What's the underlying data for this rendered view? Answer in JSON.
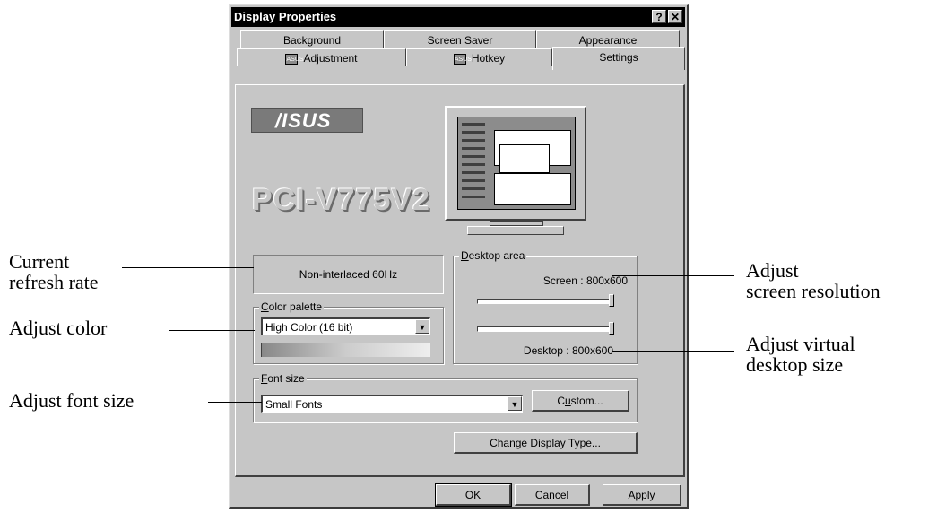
{
  "window": {
    "title": "Display Properties",
    "help_glyph": "?",
    "close_glyph": "✕"
  },
  "tabs": {
    "row_back": [
      "Background",
      "Screen Saver",
      "Appearance"
    ],
    "row_front": [
      "Adjustment",
      "Hotkey",
      "Settings"
    ],
    "active": "Settings",
    "tab_icon_text": "ASUS"
  },
  "panel": {
    "brand_logo": "/ISUS",
    "model_name": "PCI-V775V2",
    "refresh_rate": "Non-interlaced 60Hz",
    "color_palette": {
      "legend_key": "C",
      "legend_rest": "olor palette",
      "selected": "High Color (16 bit)"
    },
    "desktop_area": {
      "legend_key": "D",
      "legend_rest": "esktop area",
      "screen_label": "Screen : 800x600",
      "desktop_label": "Desktop : 800x600",
      "screen_slider_fraction": 1.0,
      "desktop_slider_fraction": 1.0
    },
    "font_size": {
      "legend_key": "F",
      "legend_rest": "ont size",
      "selected": "Small Fonts",
      "custom_pre": "C",
      "custom_key": "u",
      "custom_post": "stom..."
    },
    "change_display_type": {
      "pre": "Change Display ",
      "key": "T",
      "post": "ype..."
    }
  },
  "buttons": {
    "ok": "OK",
    "cancel": "Cancel",
    "apply_key": "A",
    "apply_rest": "pply"
  },
  "annotations": {
    "refresh_line1": "Current",
    "refresh_line2": "refresh rate",
    "color": "Adjust color",
    "font": "Adjust font size",
    "resolution_line1": "Adjust",
    "resolution_line2": "screen resolution",
    "virtual_line1": "Adjust virtual",
    "virtual_line2": "desktop size"
  },
  "colors": {
    "face": "#c6c6c6",
    "titlebar": "#000000",
    "shadow": "#404040",
    "highlight": "#ffffff"
  },
  "icons": [
    "help-icon",
    "close-icon",
    "dropdown-arrow-icon",
    "asus-tab-icon",
    "monitor-icon"
  ]
}
